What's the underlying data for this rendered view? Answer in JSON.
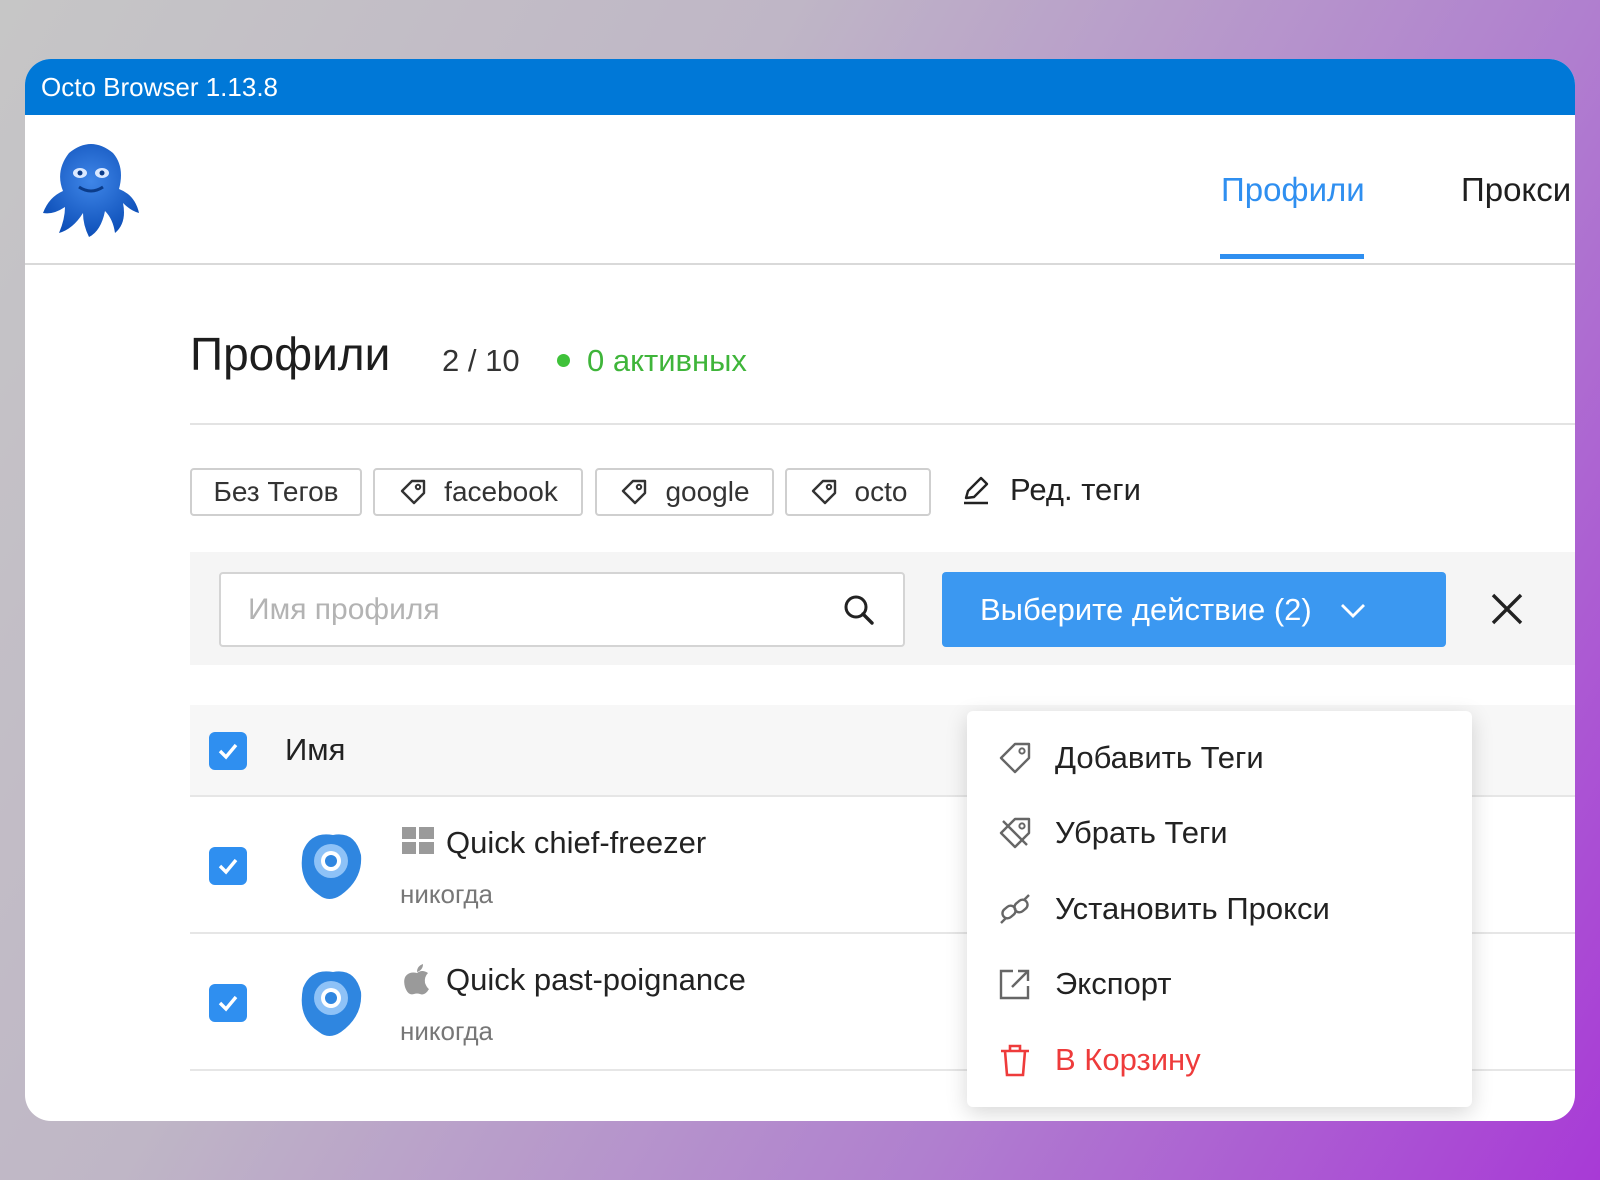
{
  "window": {
    "title": "Octo Browser 1.13.8"
  },
  "nav": {
    "tabs": [
      {
        "label": "Профили",
        "active": true
      },
      {
        "label": "Прокси",
        "active": false
      }
    ]
  },
  "page": {
    "title": "Профили",
    "count": "2 / 10",
    "active_status": "0 активных"
  },
  "tags": {
    "items": [
      {
        "label": "Без Тегов",
        "icon": "none"
      },
      {
        "label": "facebook",
        "icon": "tag-icon"
      },
      {
        "label": "google",
        "icon": "tag-icon"
      },
      {
        "label": "octo",
        "icon": "tag-icon"
      }
    ],
    "edit_label": "Ред. теги"
  },
  "search": {
    "placeholder": "Имя профиля",
    "value": ""
  },
  "action_button": {
    "label": "Выберите действие (2)"
  },
  "table": {
    "header": {
      "name_label": "Имя",
      "all_selected": true
    },
    "rows": [
      {
        "name": "Quick chief-freezer",
        "last_run": "никогда",
        "os": "windows-icon",
        "selected": true
      },
      {
        "name": "Quick past-poignance",
        "last_run": "никогда",
        "os": "apple-icon",
        "selected": true
      }
    ]
  },
  "dropdown": {
    "items": [
      {
        "label": "Добавить Теги",
        "icon": "tag-add-icon"
      },
      {
        "label": "Убрать Теги",
        "icon": "tag-remove-icon"
      },
      {
        "label": "Установить Прокси",
        "icon": "proxy-link-icon"
      },
      {
        "label": "Экспорт",
        "icon": "export-icon"
      },
      {
        "label": "В Корзину",
        "icon": "trash-icon",
        "danger": true
      }
    ]
  },
  "colors": {
    "titlebar": "#0078d7",
    "accent": "#2f8ff0",
    "active_green": "#3fb53a",
    "danger": "#ee3b3b"
  }
}
